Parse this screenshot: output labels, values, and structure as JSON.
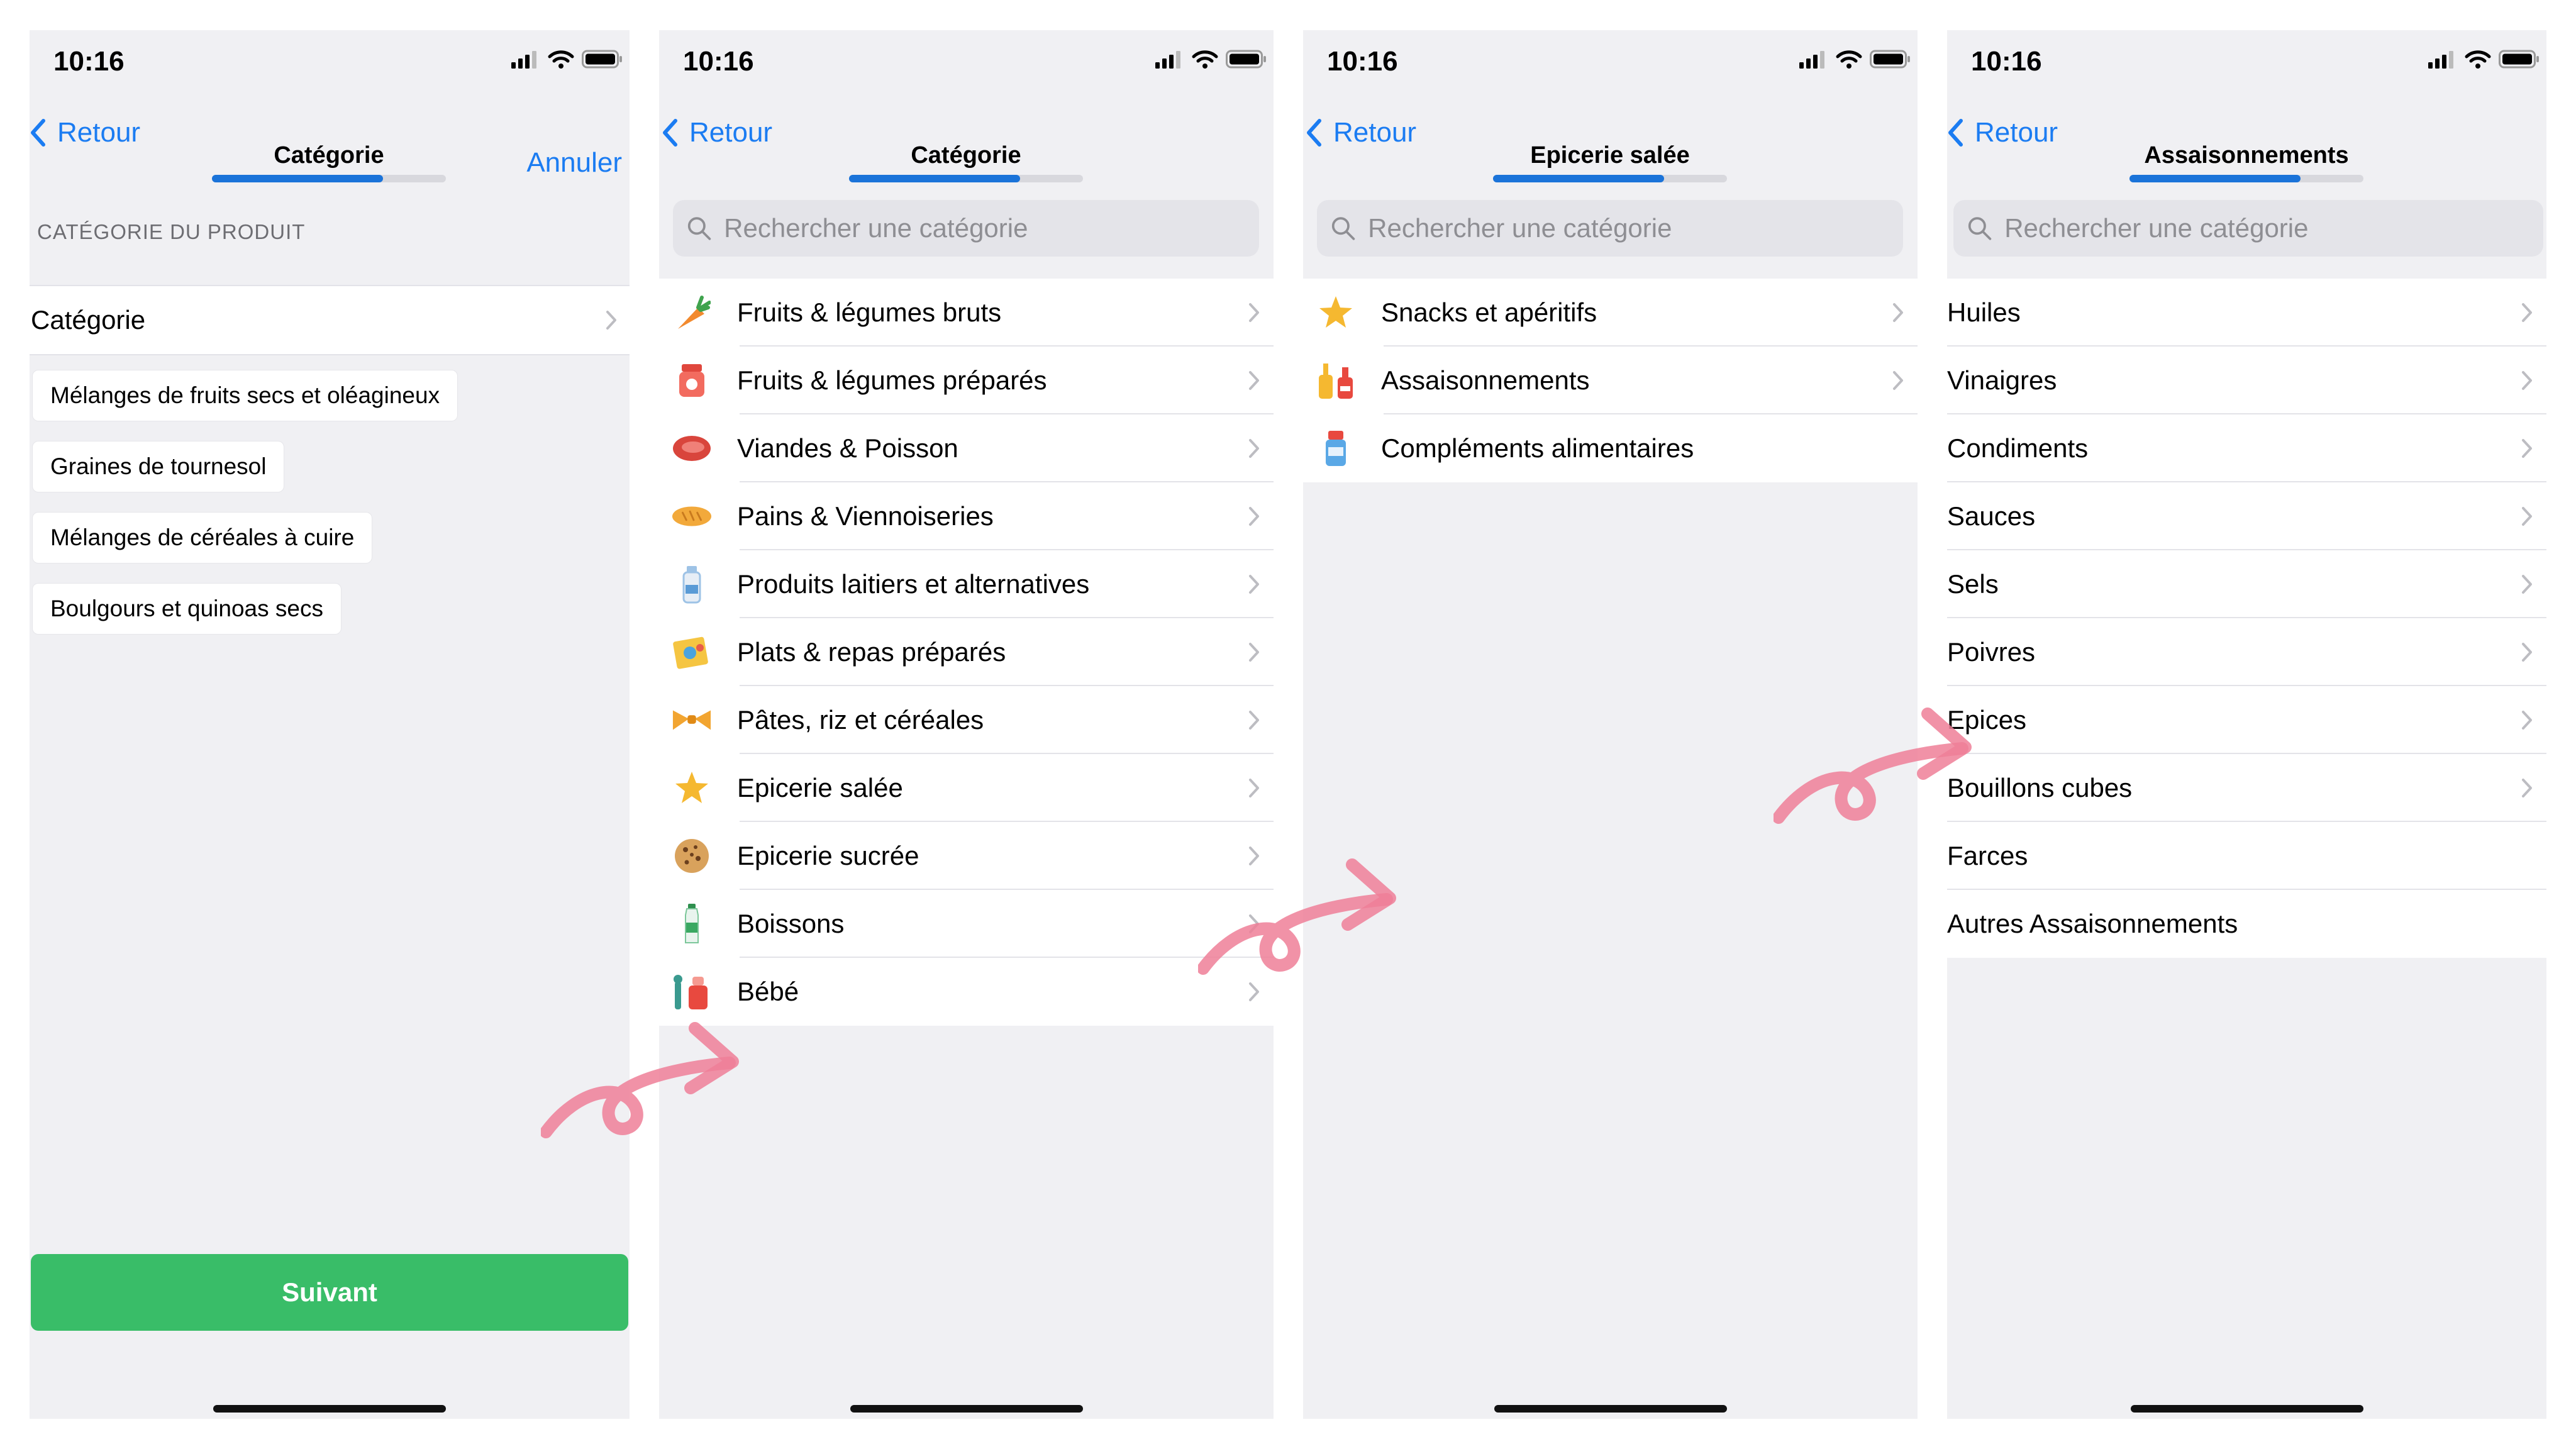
{
  "colors": {
    "accent": "#1b7cf2",
    "progress": "#1a73d9",
    "button": "#39bd68",
    "arrow": "#ef7f98"
  },
  "screen1": {
    "time": "10:16",
    "back_label": "Retour",
    "title": "Catégorie",
    "cancel_label": "Annuler",
    "section_header": "CATÉGORIE DU PRODUIT",
    "category_row": "Catégorie",
    "chips": [
      "Mélanges de fruits secs et oléagineux",
      "Graines de tournesol",
      "Mélanges de céréales à cuire",
      "Boulgours et quinoas secs"
    ],
    "next_label": "Suivant"
  },
  "screen2": {
    "time": "10:16",
    "back_label": "Retour",
    "title": "Catégorie",
    "search_placeholder": "Rechercher une catégorie",
    "items": [
      {
        "label": "Fruits & légumes bruts",
        "icon": "carrot-icon"
      },
      {
        "label": "Fruits & légumes préparés",
        "icon": "jar-icon"
      },
      {
        "label": "Viandes & Poisson",
        "icon": "meat-icon"
      },
      {
        "label": "Pains & Viennoiseries",
        "icon": "bread-icon"
      },
      {
        "label": "Produits laitiers et alternatives",
        "icon": "milk-bottle-icon"
      },
      {
        "label": "Plats & repas préparés",
        "icon": "ready-meal-icon"
      },
      {
        "label": "Pâtes, riz et céréales",
        "icon": "pasta-icon"
      },
      {
        "label": "Epicerie salée",
        "icon": "snack-star-icon"
      },
      {
        "label": "Epicerie sucrée",
        "icon": "cookie-icon"
      },
      {
        "label": "Boissons",
        "icon": "water-bottle-icon"
      },
      {
        "label": "Bébé",
        "icon": "baby-bottle-icon"
      }
    ]
  },
  "screen3": {
    "time": "10:16",
    "back_label": "Retour",
    "title": "Epicerie salée",
    "search_placeholder": "Rechercher une catégorie",
    "items": [
      {
        "label": "Snacks et apéritifs",
        "icon": "snack-star-icon",
        "chevron": true
      },
      {
        "label": "Assaisonnements",
        "icon": "condiment-bottles-icon",
        "chevron": true
      },
      {
        "label": "Compléments alimentaires",
        "icon": "supplement-bottle-icon",
        "chevron": false
      }
    ]
  },
  "screen4": {
    "time": "10:16",
    "back_label": "Retour",
    "title": "Assaisonnements",
    "search_placeholder": "Rechercher une catégorie",
    "items": [
      {
        "label": "Huiles",
        "chevron": true
      },
      {
        "label": "Vinaigres",
        "chevron": true
      },
      {
        "label": "Condiments",
        "chevron": true
      },
      {
        "label": "Sauces",
        "chevron": true
      },
      {
        "label": "Sels",
        "chevron": true
      },
      {
        "label": "Poivres",
        "chevron": true
      },
      {
        "label": "Epices",
        "chevron": true
      },
      {
        "label": "Bouillons cubes",
        "chevron": true
      },
      {
        "label": "Farces",
        "chevron": false
      },
      {
        "label": "Autres Assaisonnements",
        "chevron": false
      }
    ]
  }
}
